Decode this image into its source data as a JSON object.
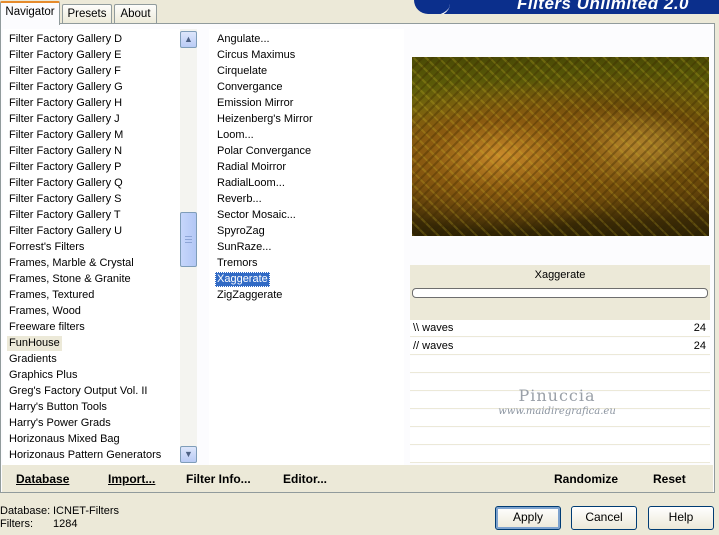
{
  "tabs": [
    "Navigator",
    "Presets",
    "About"
  ],
  "banner_title": "Filters Unlimited 2.0",
  "categories": [
    "Filter Factory Gallery D",
    "Filter Factory Gallery E",
    "Filter Factory Gallery F",
    "Filter Factory Gallery G",
    "Filter Factory Gallery H",
    "Filter Factory Gallery J",
    "Filter Factory Gallery M",
    "Filter Factory Gallery N",
    "Filter Factory Gallery P",
    "Filter Factory Gallery Q",
    "Filter Factory Gallery S",
    "Filter Factory Gallery T",
    "Filter Factory Gallery U",
    "Forrest's Filters",
    "Frames, Marble & Crystal",
    "Frames, Stone & Granite",
    "Frames, Textured",
    "Frames, Wood",
    "Freeware filters",
    "FunHouse",
    "Gradients",
    "Graphics Plus",
    "Greg's Factory Output Vol. II",
    "Harry's Button Tools",
    "Harry's Power Grads",
    "Horizonaus Mixed Bag",
    "Horizonaus Pattern Generators"
  ],
  "selected_category": "FunHouse",
  "filters": [
    "Angulate...",
    "Circus Maximus",
    "Cirquelate",
    "Convergance",
    "Emission Mirror",
    "Heizenberg's Mirror",
    "Loom...",
    "Polar Convergance",
    "Radial Moirror",
    "RadialLoom...",
    "Reverb...",
    "Sector Mosaic...",
    "SpyroZag",
    "SunRaze...",
    "Tremors",
    "Xaggerate",
    "ZigZaggerate"
  ],
  "selected_filter": "Xaggerate",
  "current_filter_name": "Xaggerate",
  "parameters": [
    {
      "name": "\\\\ waves",
      "value": "24"
    },
    {
      "name": "// waves",
      "value": "24"
    }
  ],
  "watermark": {
    "name": "Pinuccia",
    "url": "www.maidiregrafica.eu"
  },
  "toolbar": {
    "database": "Database",
    "import": "Import...",
    "filter_info": "Filter Info...",
    "editor": "Editor...",
    "randomize": "Randomize",
    "reset": "Reset"
  },
  "status": {
    "database_label": "Database:",
    "database_value": "ICNET-Filters",
    "filters_label": "Filters:",
    "filters_value": "1284"
  },
  "buttons": {
    "apply": "Apply",
    "cancel": "Cancel",
    "help": "Help"
  }
}
